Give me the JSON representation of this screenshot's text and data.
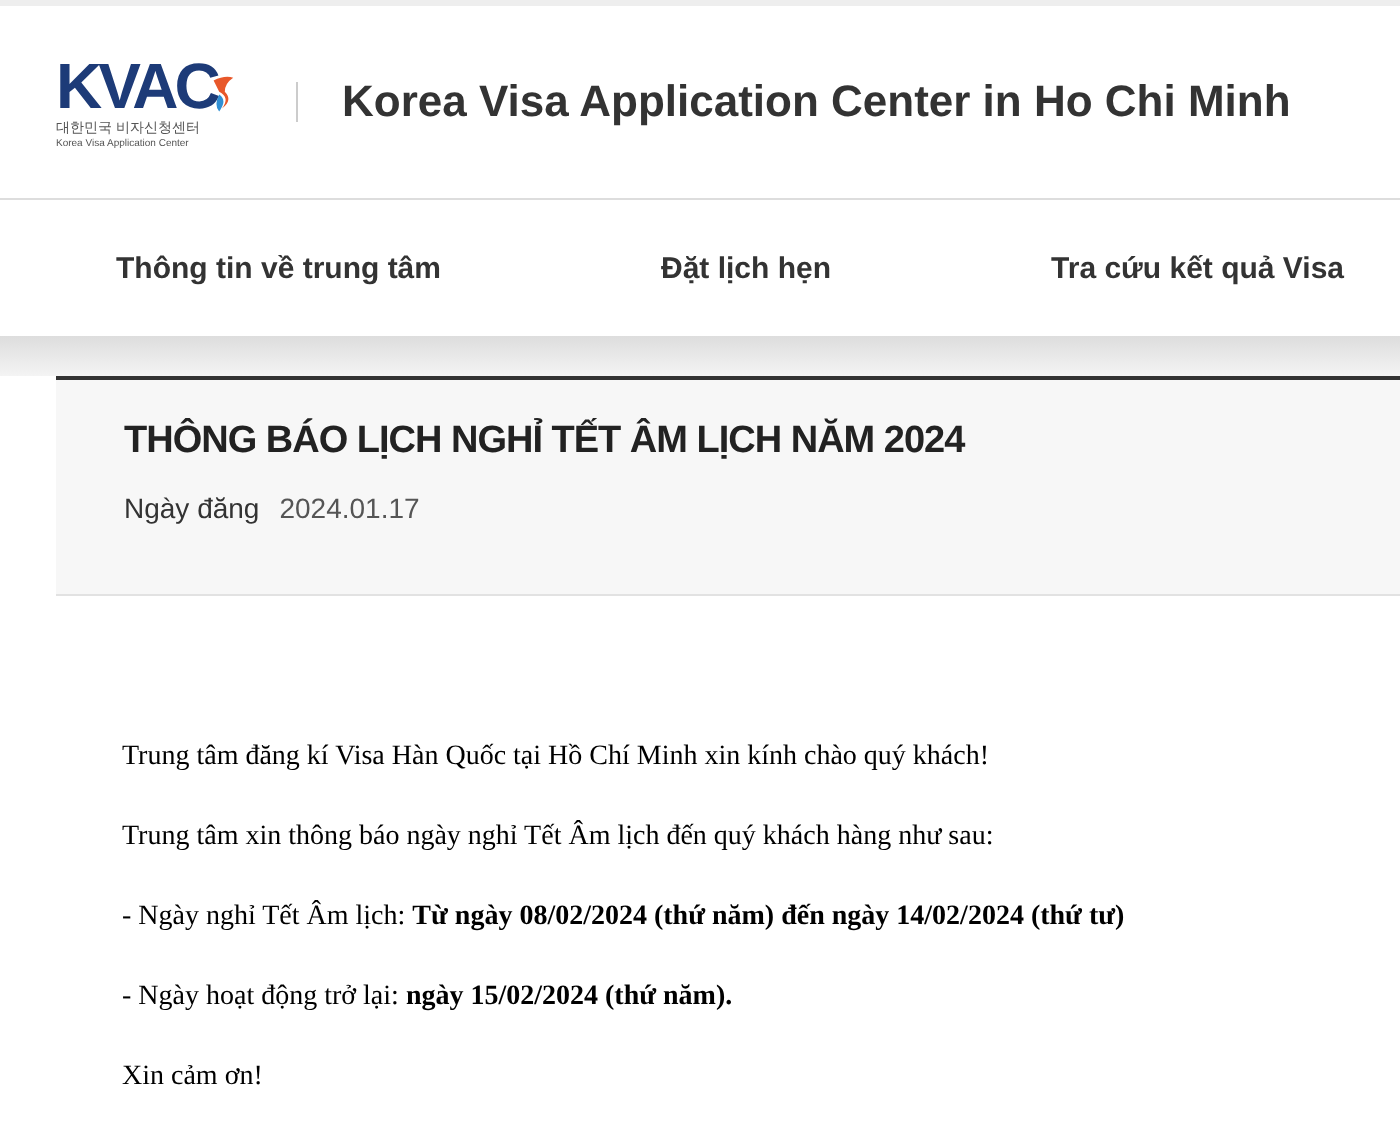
{
  "logo": {
    "mark": "KVAC",
    "korean": "대한민국 비자신청센터",
    "english": "Korea Visa Application Center"
  },
  "site_title": "Korea Visa Application Center in Ho Chi Minh",
  "nav": [
    "Thông tin về trung tâm",
    "Đặt lịch hẹn",
    "Tra cứu kết quả Visa"
  ],
  "notice": {
    "title": "THÔNG BÁO LỊCH NGHỈ TẾT ÂM LỊCH NĂM 2024",
    "date_label": "Ngày đăng",
    "date": "2024.01.17"
  },
  "body": [
    "Trung tâm đăng kí Visa Hàn Quốc tại Hồ Chí Minh xin kính chào quý khách!",
    "Trung tâm xin thông báo ngày nghỉ Tết Âm lịch đến quý khách hàng như sau:",
    "-  Ngày nghỉ Tết Âm lịch: **Từ ngày 08/02/2024 (thứ năm) đến ngày 14/02/2024 (thứ tư)**",
    "-  Ngày hoạt động trở lại: **ngày 15/02/2024 (thứ năm).**",
    "Xin cảm ơn!"
  ]
}
